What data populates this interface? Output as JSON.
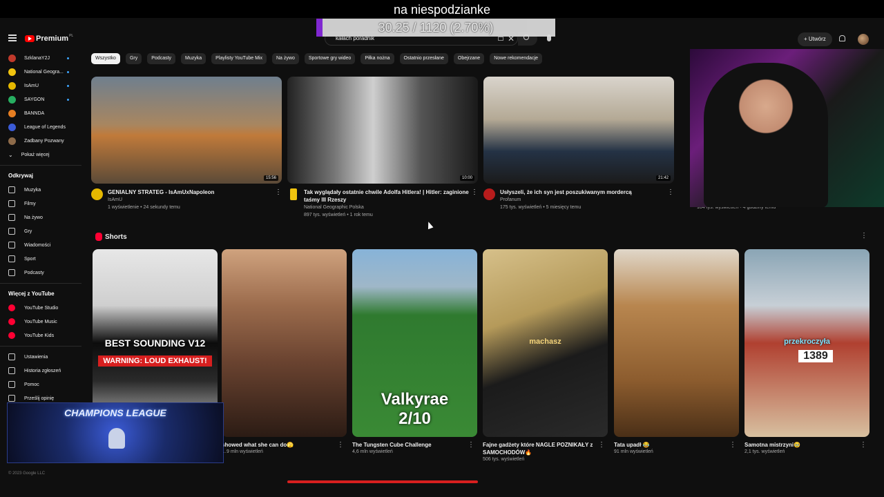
{
  "overlay": {
    "title": "na niespodzianke",
    "progress_text": "30.25 / 1120 (2.70%)",
    "progress_fraction": 0.027,
    "progress_color": "#8a2be2"
  },
  "header": {
    "logo_text": "Premium",
    "logo_region": "PL",
    "search_value": "kałach poradnik",
    "create_label": "Utwórz"
  },
  "sidebar": {
    "subscriptions": [
      {
        "label": "SzklanaY2J",
        "color": "#c0392b",
        "dot": true
      },
      {
        "label": "National Geogra...",
        "color": "#f1c40f",
        "dot": true
      },
      {
        "label": "IsAmU",
        "color": "#e5b800",
        "dot": true
      },
      {
        "label": "SAYGON",
        "color": "#27ae60",
        "dot": true
      },
      {
        "label": "BANNDA",
        "color": "#e67e22",
        "dot": false
      },
      {
        "label": "League of Legends",
        "color": "#3b5bd6",
        "dot": false
      },
      {
        "label": "Zadbany Pozwany",
        "color": "#8e6b4a",
        "dot": false
      }
    ],
    "show_more": "Pokaż więcej",
    "explore_heading": "Odkrywaj",
    "explore": [
      "Muzyka",
      "Filmy",
      "Na żywo",
      "Gry",
      "Wiadomości",
      "Sport",
      "Podcasty"
    ],
    "more_heading": "Więcej z YouTube",
    "more": [
      "YouTube Studio",
      "YouTube Music",
      "YouTube Kids"
    ],
    "settings": [
      "Ustawienia",
      "Historia zgłoszeń",
      "Pomoc",
      "Prześlij opinię"
    ],
    "footer": "© 2023 Google LLC"
  },
  "chips": [
    "Wszystko",
    "Gry",
    "Podcasty",
    "Muzyka",
    "Playlisty YouTube Mix",
    "Na żywo",
    "Sportowe gry wideo",
    "Piłka nożna",
    "Ostatnio przesłane",
    "Obejrzane",
    "Nowe rekomendacje"
  ],
  "videos": [
    {
      "title": "GENIALNY STRATEG - IsAmUxNapoleon",
      "channel": "IsAmU",
      "meta": "1 wyświetlenie • 24 sekundy temu",
      "duration": "15:56",
      "avatar_color": "#e5b800"
    },
    {
      "title": "Tak wyglądały ostatnie chwile Adolfa Hitlera! | Hitler: zaginione taśmy III Rzeszy",
      "channel": "National Geographic Polska",
      "meta": "897 tys. wyświetleń • 1 rok temu",
      "duration": "10:00",
      "avatar_color": "#f1c40f"
    },
    {
      "title": "Usłyszeli, że ich syn jest poszukiwanym mordercą",
      "channel": "Profanum",
      "meta": "175 tys. wyświetleń • 5 miesięcy temu",
      "duration": "21:42",
      "avatar_color": "#b71c1c"
    }
  ],
  "fourth_video_meta": "104 tys. wyświetleń • 4 godziny temu",
  "shorts": {
    "label": "Shorts",
    "items": [
      {
        "title": "",
        "views": "",
        "captions": [
          "BEST SOUNDING V12",
          "WARNING: LOUD EXHAUST!"
        ]
      },
      {
        "title": "showed what she can do🫣",
        "views": "…9 mln wyświetleń",
        "captions": []
      },
      {
        "title": "The Tungsten Cube Challenge",
        "views": "4,6 mln wyświetleń",
        "captions": [
          "Valkyrae",
          "2/10"
        ]
      },
      {
        "title": "Fajne gadżety które NAGLE POZNIKAŁY z SAMOCHODÓW🔥",
        "views": "506 tys. wyświetleń",
        "captions": [
          "machasz"
        ]
      },
      {
        "title": "Tata upadł 😂",
        "views": "91 mln wyświetleń",
        "captions": []
      },
      {
        "title": "Samotna mistrzyni🥹",
        "views": "2,1 tys. wyświetleń",
        "captions": [
          "przekroczyła",
          "1389"
        ]
      }
    ]
  },
  "champions_banner": "CHAMPIONS LEAGUE"
}
